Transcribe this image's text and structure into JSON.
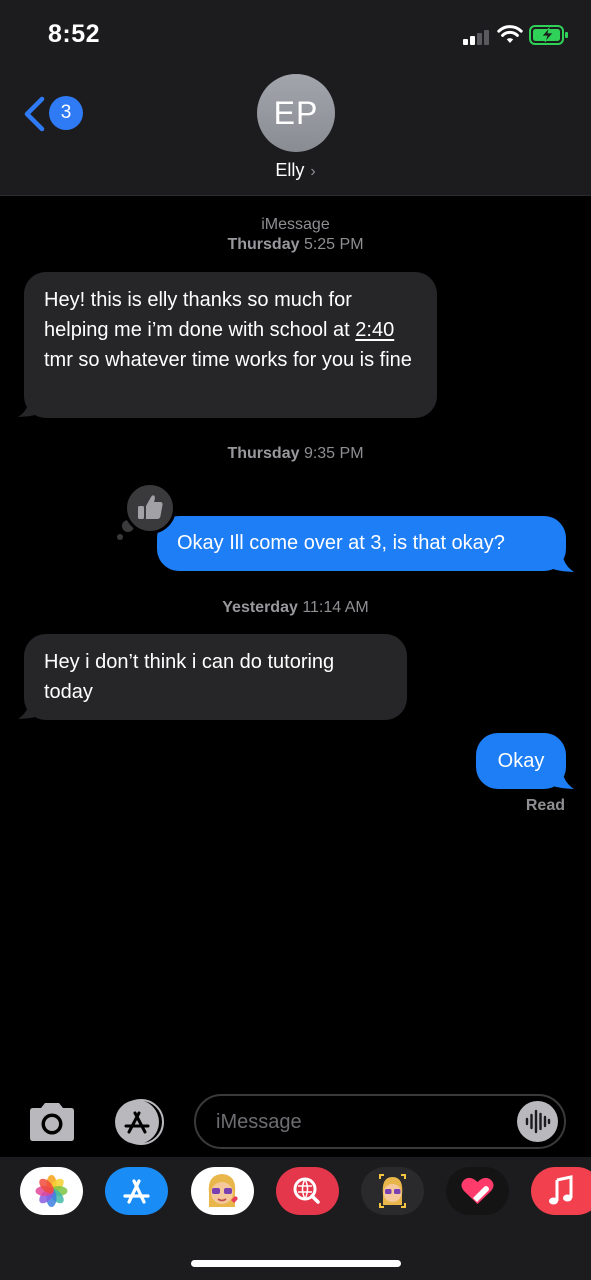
{
  "status_bar": {
    "time": "8:52",
    "signal_icon": "signal-bars-icon",
    "wifi_icon": "wifi-icon",
    "battery_icon": "battery-charging-icon",
    "battery_color": "#30d158"
  },
  "header": {
    "back_count": "3",
    "avatar_initials": "EP",
    "contact_name": "Elly",
    "accent_color": "#2f7bf6"
  },
  "conversation": {
    "service_label": "iMessage",
    "messages": [
      {
        "stamp_day": "Thursday",
        "stamp_time": "5:25 PM",
        "direction": "incoming",
        "text_before": "Hey! this is elly thanks so much for helping me i’m done with school at ",
        "text_link": "2:40",
        "text_after": " tmr so whatever time works for you is fine"
      },
      {
        "stamp_day": "Thursday",
        "stamp_time": "9:35 PM",
        "direction": "outgoing",
        "text": "Okay Ill come over at 3, is that okay?",
        "tapback_icon": "thumbs-up-icon"
      },
      {
        "stamp_day": "Yesterday",
        "stamp_time": "11:14 AM",
        "direction": "incoming",
        "text": "Hey i don’t think i can do tutoring today"
      },
      {
        "direction": "outgoing",
        "text": "Okay",
        "receipt": "Read"
      }
    ],
    "incoming_color": "#262628",
    "outgoing_color": "#1e7ef6"
  },
  "input_bar": {
    "camera_icon": "camera-icon",
    "apps_icon": "app-store-icon",
    "placeholder": "iMessage",
    "audio_icon": "audio-waveform-icon"
  },
  "app_drawer": {
    "apps": [
      "photos-icon",
      "app-store-icon",
      "memoji-stickers-icon",
      "search-images-icon",
      "animoji-icon",
      "digital-touch-icon",
      "music-icon"
    ]
  }
}
